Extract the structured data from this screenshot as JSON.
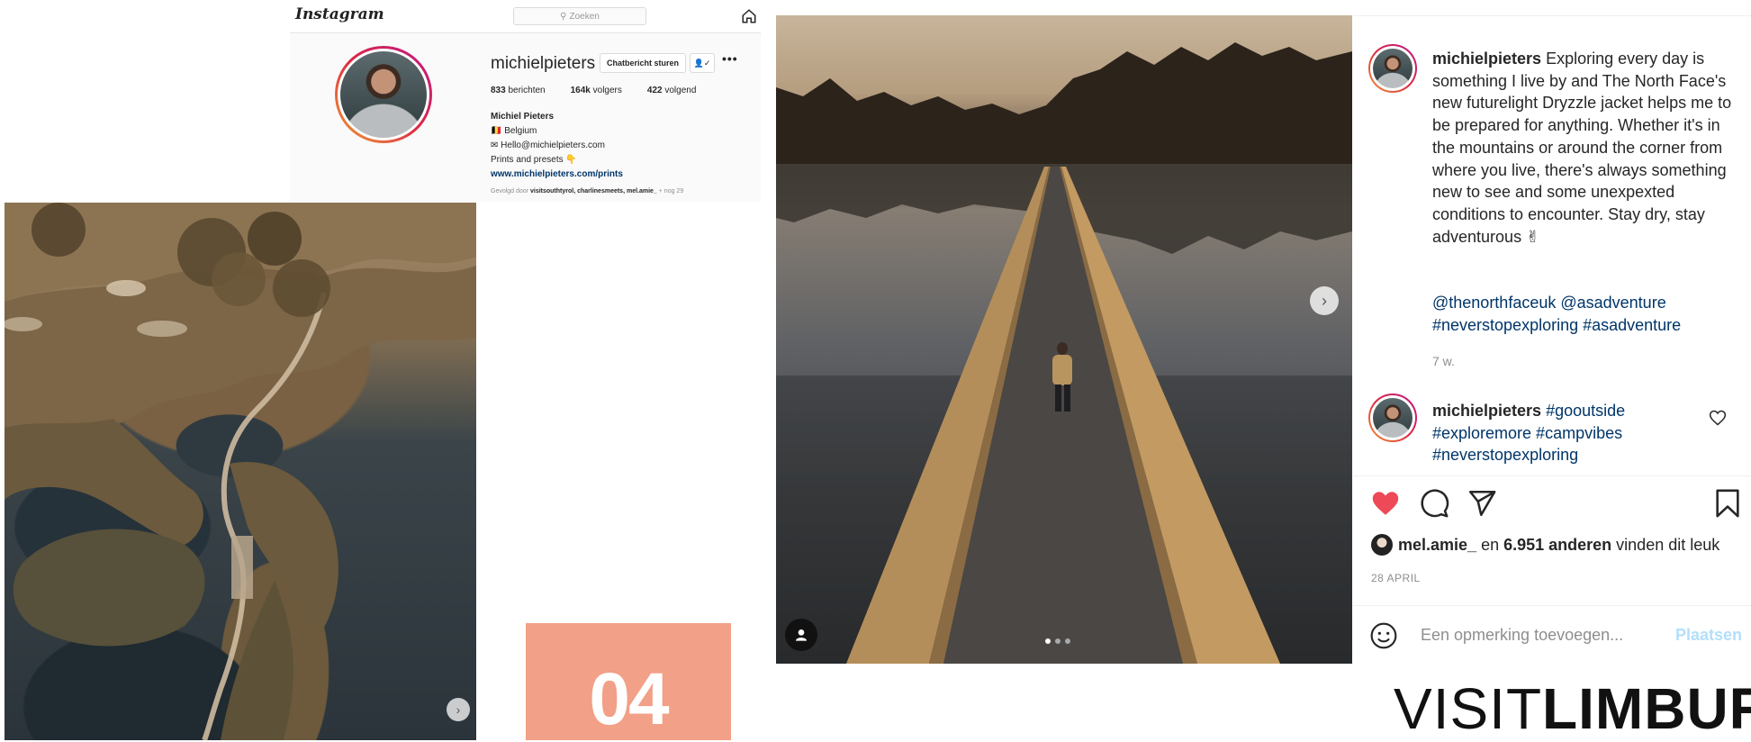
{
  "instagram_header": {
    "logo": "Instagram",
    "search_placeholder": "Zoeken"
  },
  "profile": {
    "username": "michielpieters",
    "message_button": "Chatbericht sturen",
    "posts": "833",
    "posts_label": "berichten",
    "followers": "164k",
    "followers_label": "volgers",
    "following": "422",
    "following_label": "volgend",
    "full_name": "Michiel Pieters",
    "location": "🇧🇪 Belgium",
    "email": "✉ Hello@michielpieters.com",
    "bio_line": "Prints and presets 👇",
    "website": "www.michielpieters.com/prints",
    "followed_by_prefix": "Gevolgd door ",
    "followed_by_names": "visitsouthtyrol, charlinesmeets, mel.amie_",
    "followed_by_more": " + nog 29"
  },
  "number_box": {
    "number": "04",
    "color": "#f2a087"
  },
  "post": {
    "carousel_dots": 3,
    "active_dot": 1,
    "caption_user": "michielpieters",
    "caption_text": " Exploring every day is something I live by and The North Face's new futurelight Dryzzle jacket helps me to be prepared for anything. Whether it's in the mountains or around the corner from where you live, there's always something new to see and some unexpexted conditions to encounter. Stay dry, stay adventurous ✌",
    "caption_hashtags": "@thenorthfaceuk @asadventure #neverstopexploring #asadventure",
    "caption_age": "7 w.",
    "comment_user": "michielpieters",
    "comment_text": " #gooutside #exploremore #campvibes #neverstopexploring",
    "likes_user": "mel.amie_",
    "likes_mid": " en ",
    "likes_count": "6.951 anderen",
    "likes_suffix": " vinden dit leuk",
    "date": "28 APRIL",
    "comment_placeholder": "Een opmerking toevoegen...",
    "post_button": "Plaatsen",
    "heart_color": "#ed4956"
  },
  "brand": {
    "thin": "VISIT",
    "bold": "LIMBUR"
  }
}
